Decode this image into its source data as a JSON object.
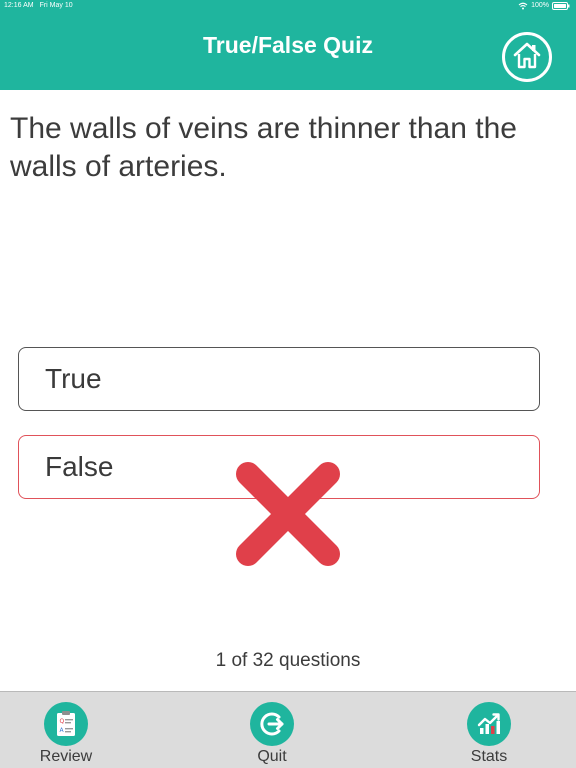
{
  "status_bar": {
    "time": "12:16 AM",
    "date": "Fri May 10",
    "battery": "100%"
  },
  "header": {
    "title": "True/False Quiz",
    "home_icon": "home-icon"
  },
  "question": {
    "text": "The walls of veins are thinner than the walls of arteries."
  },
  "answers": [
    {
      "label": "True",
      "state": "neutral"
    },
    {
      "label": "False",
      "state": "wrong"
    }
  ],
  "feedback": {
    "icon": "wrong-x-icon",
    "color": "#e0404a"
  },
  "progress": {
    "text": "1 of 32 questions"
  },
  "tab_bar": {
    "items": [
      {
        "label": "Review",
        "icon": "review-clipboard-icon"
      },
      {
        "label": "Quit",
        "icon": "exit-icon"
      },
      {
        "label": "Stats",
        "icon": "stats-chart-icon"
      }
    ]
  },
  "colors": {
    "accent": "#1fb59e",
    "wrong": "#e0404a",
    "tab_bar_bg": "#dcdcdc"
  }
}
